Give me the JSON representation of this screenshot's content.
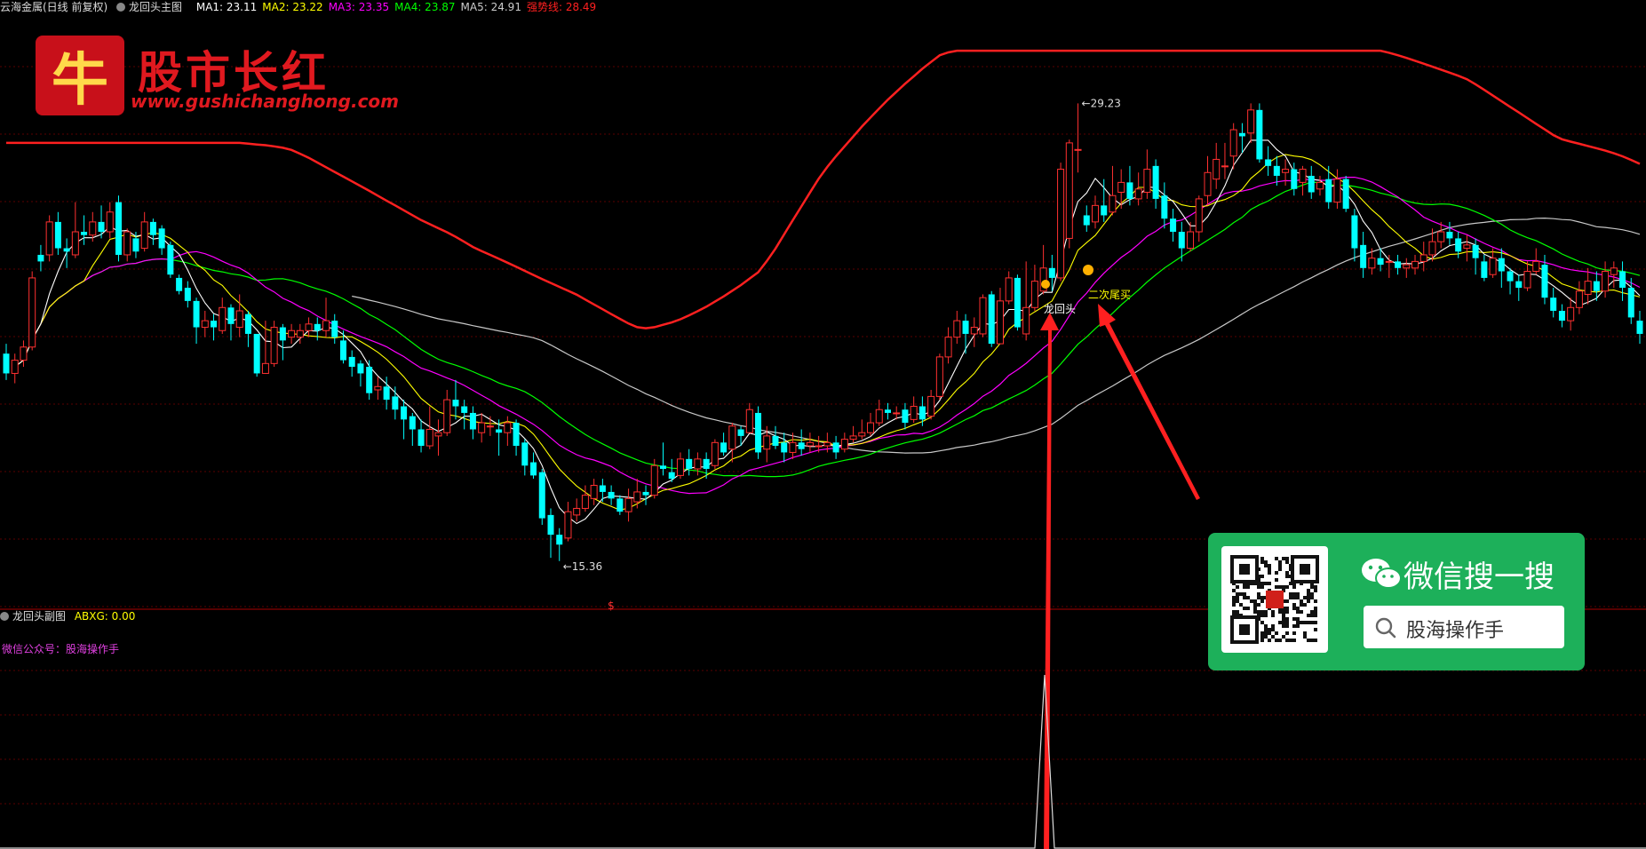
{
  "header": {
    "stock": "云海金属(日线 前复权)",
    "indicator": "龙回头主图",
    "ma": [
      {
        "label": "MA1:",
        "value": "23.11",
        "color": "#ffffff"
      },
      {
        "label": "MA2:",
        "value": "23.22",
        "color": "#ffff00"
      },
      {
        "label": "MA3:",
        "value": "23.35",
        "color": "#ff00ff"
      },
      {
        "label": "MA4:",
        "value": "23.87",
        "color": "#00ff00"
      },
      {
        "label": "MA5:",
        "value": "24.91",
        "color": "#cccccc"
      },
      {
        "label": "强势线:",
        "value": "28.49",
        "color": "#ff2020"
      }
    ]
  },
  "subpanel": {
    "title": "龙回头副图",
    "abxg": "ABXG: 0.00",
    "note": "微信公众号：股海操作手",
    "marker": "$"
  },
  "logo": {
    "glyph": "牛",
    "title": "股市长红",
    "url": "www.gushichanghong.com"
  },
  "wechat": {
    "title": "微信搜一搜",
    "search": "股海操作手"
  },
  "chart_data": {
    "type": "candlestick",
    "price_range": [
      14.0,
      31.8
    ],
    "high_label": "29.23",
    "low_label": "15.36",
    "annotations": [
      "龙回头",
      "二次尾买"
    ],
    "colors": {
      "up": "#ff3030",
      "down": "#00ffff",
      "strong_line": "#ff2020",
      "ma1": "#ffffff",
      "ma2": "#ffff00",
      "ma3": "#ff00ff",
      "ma4": "#00ff00",
      "ma5": "#c8c8c8"
    },
    "candles": [
      [
        21.6,
        21.0,
        21.9,
        20.8
      ],
      [
        21.0,
        21.4,
        21.6,
        20.7
      ],
      [
        21.4,
        21.8,
        22.0,
        21.2
      ],
      [
        21.8,
        23.9,
        24.1,
        21.7
      ],
      [
        24.6,
        24.4,
        24.9,
        24.1
      ],
      [
        24.6,
        25.6,
        25.8,
        24.4
      ],
      [
        25.6,
        24.8,
        25.9,
        24.6
      ],
      [
        24.8,
        24.7,
        25.1,
        24.2
      ],
      [
        24.6,
        25.3,
        26.2,
        24.5
      ],
      [
        25.3,
        25.2,
        25.8,
        24.9
      ],
      [
        25.2,
        25.6,
        25.9,
        25.0
      ],
      [
        25.6,
        25.3,
        26.1,
        25.1
      ],
      [
        25.3,
        25.9,
        26.2,
        25.1
      ],
      [
        26.2,
        24.6,
        26.4,
        24.4
      ],
      [
        24.6,
        25.3,
        25.4,
        24.4
      ],
      [
        25.1,
        24.7,
        25.3,
        24.5
      ],
      [
        24.8,
        25.6,
        25.9,
        24.7
      ],
      [
        25.6,
        25.2,
        25.7,
        24.9
      ],
      [
        25.4,
        24.8,
        25.5,
        24.6
      ],
      [
        24.9,
        24.0,
        25.0,
        23.9
      ],
      [
        23.9,
        23.5,
        24.0,
        23.4
      ],
      [
        23.6,
        23.2,
        23.8,
        23.0
      ],
      [
        23.2,
        22.4,
        23.3,
        21.9
      ],
      [
        22.4,
        22.6,
        22.9,
        22.1
      ],
      [
        22.6,
        22.4,
        22.8,
        22.0
      ],
      [
        22.3,
        23.0,
        23.3,
        22.2
      ],
      [
        23.0,
        22.5,
        23.1,
        22.0
      ],
      [
        22.4,
        22.9,
        23.4,
        22.1
      ],
      [
        22.8,
        22.2,
        22.9,
        21.8
      ],
      [
        22.2,
        21.0,
        22.2,
        20.9
      ],
      [
        21.0,
        21.3,
        22.6,
        21.0
      ],
      [
        21.3,
        22.4,
        22.6,
        21.2
      ],
      [
        22.4,
        22.0,
        22.5,
        21.4
      ],
      [
        22.1,
        22.3,
        22.5,
        21.9
      ],
      [
        22.1,
        22.3,
        22.5,
        21.9
      ],
      [
        22.3,
        22.5,
        22.7,
        22.1
      ],
      [
        22.5,
        22.3,
        22.7,
        22.0
      ],
      [
        22.3,
        22.6,
        23.3,
        22.1
      ],
      [
        22.6,
        22.1,
        22.8,
        21.9
      ],
      [
        22.0,
        21.4,
        22.3,
        21.3
      ],
      [
        21.5,
        21.2,
        21.7,
        20.9
      ],
      [
        21.3,
        21.0,
        21.4,
        20.6
      ],
      [
        21.2,
        20.4,
        21.4,
        20.2
      ],
      [
        20.5,
        20.6,
        20.9,
        20.2
      ],
      [
        20.6,
        20.2,
        20.9,
        19.9
      ],
      [
        20.3,
        19.9,
        20.6,
        19.6
      ],
      [
        20.0,
        19.6,
        20.2,
        19.0
      ],
      [
        19.7,
        19.3,
        19.8,
        18.8
      ],
      [
        19.3,
        18.8,
        19.6,
        18.6
      ],
      [
        18.8,
        19.3,
        20.0,
        18.7
      ],
      [
        19.1,
        19.2,
        19.6,
        18.5
      ],
      [
        19.2,
        20.2,
        20.5,
        19.1
      ],
      [
        20.2,
        20.0,
        20.8,
        19.6
      ],
      [
        20.0,
        19.8,
        20.2,
        19.3
      ],
      [
        19.8,
        19.3,
        20.0,
        19.0
      ],
      [
        19.2,
        19.5,
        19.8,
        18.9
      ],
      [
        19.4,
        19.4,
        19.7,
        19.1
      ],
      [
        19.3,
        19.2,
        19.6,
        18.5
      ],
      [
        19.2,
        19.5,
        19.7,
        18.8
      ],
      [
        19.5,
        18.8,
        19.6,
        18.5
      ],
      [
        18.9,
        18.2,
        19.0,
        17.9
      ],
      [
        18.3,
        17.9,
        18.6,
        17.8
      ],
      [
        18.0,
        16.6,
        18.1,
        16.4
      ],
      [
        16.7,
        16.1,
        16.9,
        15.4
      ],
      [
        16.1,
        15.8,
        16.3,
        15.3
      ],
      [
        16.0,
        16.8,
        17.1,
        15.9
      ],
      [
        16.7,
        16.9,
        17.2,
        16.5
      ],
      [
        16.9,
        17.3,
        17.6,
        16.8
      ],
      [
        17.2,
        17.6,
        17.8,
        17.0
      ],
      [
        17.6,
        17.4,
        17.8,
        17.1
      ],
      [
        17.4,
        17.2,
        17.6,
        17.0
      ],
      [
        17.2,
        16.8,
        17.3,
        16.7
      ],
      [
        16.8,
        17.2,
        17.5,
        16.5
      ],
      [
        17.1,
        17.4,
        17.8,
        16.9
      ],
      [
        17.4,
        17.3,
        17.6,
        17.0
      ],
      [
        17.3,
        18.2,
        18.4,
        17.2
      ],
      [
        18.2,
        18.1,
        18.9,
        17.9
      ],
      [
        18.0,
        17.8,
        18.4,
        17.7
      ],
      [
        17.9,
        18.4,
        18.6,
        17.8
      ],
      [
        18.4,
        18.1,
        18.7,
        17.9
      ],
      [
        18.1,
        18.4,
        18.6,
        17.9
      ],
      [
        18.4,
        18.1,
        18.6,
        17.8
      ],
      [
        18.2,
        18.9,
        19.0,
        18.1
      ],
      [
        18.9,
        18.6,
        19.2,
        18.5
      ],
      [
        18.7,
        19.4,
        19.5,
        18.3
      ],
      [
        19.3,
        19.1,
        19.4,
        18.8
      ],
      [
        19.2,
        19.9,
        20.1,
        19.2
      ],
      [
        19.8,
        18.6,
        20.0,
        18.4
      ],
      [
        18.7,
        19.1,
        19.4,
        18.3
      ],
      [
        19.1,
        18.8,
        19.4,
        18.7
      ],
      [
        18.9,
        18.6,
        19.2,
        18.3
      ],
      [
        18.6,
        18.9,
        19.2,
        18.4
      ],
      [
        18.9,
        18.7,
        19.3,
        18.5
      ],
      [
        18.8,
        18.9,
        19.2,
        18.6
      ],
      [
        18.8,
        18.8,
        19.1,
        18.6
      ],
      [
        18.8,
        18.9,
        19.2,
        18.6
      ],
      [
        18.9,
        18.6,
        19.1,
        18.4
      ],
      [
        18.7,
        19.0,
        19.2,
        18.6
      ],
      [
        19.0,
        19.1,
        19.4,
        18.9
      ],
      [
        19.1,
        19.2,
        19.6,
        19.0
      ],
      [
        19.2,
        19.5,
        19.8,
        19.1
      ],
      [
        19.5,
        19.9,
        20.2,
        19.4
      ],
      [
        19.9,
        19.8,
        20.1,
        19.6
      ],
      [
        19.8,
        19.8,
        20.0,
        19.6
      ],
      [
        19.9,
        19.5,
        20.1,
        19.3
      ],
      [
        19.6,
        20.0,
        20.3,
        19.5
      ],
      [
        20.0,
        19.6,
        20.3,
        19.4
      ],
      [
        19.7,
        20.3,
        20.5,
        19.6
      ],
      [
        20.3,
        21.5,
        21.6,
        20.2
      ],
      [
        21.5,
        22.1,
        22.4,
        21.3
      ],
      [
        22.1,
        22.6,
        22.9,
        21.9
      ],
      [
        22.6,
        22.2,
        22.8,
        21.6
      ],
      [
        22.2,
        22.4,
        22.7,
        21.8
      ],
      [
        22.2,
        23.3,
        23.4,
        22.1
      ],
      [
        23.4,
        21.9,
        23.5,
        21.8
      ],
      [
        21.9,
        23.2,
        23.6,
        21.9
      ],
      [
        23.2,
        23.9,
        24.1,
        23.1
      ],
      [
        23.9,
        22.4,
        24.0,
        22.3
      ],
      [
        22.2,
        23.0,
        24.4,
        22.0
      ],
      [
        23.0,
        23.8,
        24.3,
        22.9
      ],
      [
        23.5,
        24.2,
        24.9,
        23.4
      ],
      [
        24.2,
        23.9,
        24.6,
        23.5
      ],
      [
        23.9,
        27.2,
        27.4,
        23.8
      ],
      [
        25.1,
        28.0,
        28.1,
        24.8
      ],
      [
        27.8,
        27.8,
        29.2,
        27.1
      ],
      [
        25.8,
        25.5,
        26.1,
        25.3
      ],
      [
        25.6,
        26.1,
        26.4,
        25.4
      ],
      [
        26.1,
        25.8,
        26.9,
        25.6
      ],
      [
        25.9,
        26.4,
        27.3,
        25.8
      ],
      [
        26.5,
        26.8,
        27.2,
        26.0
      ],
      [
        26.8,
        26.3,
        27.3,
        26.1
      ],
      [
        26.3,
        26.6,
        27.1,
        26.1
      ],
      [
        26.5,
        27.2,
        27.8,
        26.3
      ],
      [
        27.3,
        26.3,
        27.5,
        26.0
      ],
      [
        26.4,
        25.7,
        26.8,
        25.4
      ],
      [
        25.7,
        25.3,
        26.0,
        25.0
      ],
      [
        25.3,
        24.8,
        25.6,
        24.4
      ],
      [
        24.8,
        25.3,
        25.6,
        24.7
      ],
      [
        25.3,
        26.3,
        26.4,
        25.0
      ],
      [
        26.4,
        27.1,
        27.6,
        26.1
      ],
      [
        26.9,
        27.5,
        28.0,
        26.6
      ],
      [
        27.3,
        27.3,
        28.0,
        26.9
      ],
      [
        27.6,
        28.4,
        28.6,
        27.2
      ],
      [
        28.3,
        28.2,
        28.6,
        27.7
      ],
      [
        28.3,
        29.0,
        29.2,
        28.0
      ],
      [
        29.0,
        27.5,
        29.2,
        27.4
      ],
      [
        27.5,
        27.3,
        27.9,
        27.0
      ],
      [
        27.3,
        27.0,
        27.6,
        26.7
      ],
      [
        27.1,
        27.2,
        27.5,
        26.7
      ],
      [
        27.2,
        26.6,
        27.4,
        26.4
      ],
      [
        26.8,
        27.2,
        27.3,
        26.4
      ],
      [
        27.0,
        26.5,
        27.3,
        26.3
      ],
      [
        26.6,
        26.8,
        27.0,
        26.4
      ],
      [
        26.9,
        26.2,
        27.3,
        26.0
      ],
      [
        26.2,
        26.9,
        27.2,
        26.0
      ],
      [
        26.9,
        26.0,
        27.0,
        25.9
      ],
      [
        25.8,
        24.8,
        26.0,
        24.4
      ],
      [
        24.9,
        24.2,
        25.3,
        23.9
      ],
      [
        24.2,
        24.5,
        24.8,
        24.0
      ],
      [
        24.5,
        24.3,
        24.8,
        24.1
      ],
      [
        24.4,
        24.4,
        24.6,
        23.9
      ],
      [
        24.4,
        24.2,
        24.6,
        24.0
      ],
      [
        24.2,
        24.3,
        24.5,
        23.9
      ],
      [
        24.2,
        24.4,
        24.6,
        24.0
      ],
      [
        24.4,
        24.6,
        25.0,
        24.1
      ],
      [
        24.6,
        25.0,
        25.4,
        24.4
      ],
      [
        25.0,
        25.3,
        25.6,
        24.8
      ],
      [
        25.3,
        25.1,
        25.6,
        24.9
      ],
      [
        25.1,
        24.7,
        25.3,
        24.5
      ],
      [
        24.8,
        24.9,
        25.2,
        24.4
      ],
      [
        24.9,
        24.5,
        25.1,
        24.0
      ],
      [
        24.4,
        23.9,
        24.6,
        23.8
      ],
      [
        24.0,
        24.5,
        24.8,
        23.9
      ],
      [
        24.5,
        24.1,
        24.8,
        23.6
      ],
      [
        24.1,
        23.8,
        24.2,
        23.4
      ],
      [
        23.8,
        23.6,
        24.0,
        23.2
      ],
      [
        23.6,
        24.1,
        24.4,
        23.5
      ],
      [
        24.1,
        24.4,
        24.8,
        24.0
      ],
      [
        24.3,
        23.3,
        24.6,
        23.1
      ],
      [
        23.3,
        22.9,
        23.6,
        22.7
      ],
      [
        22.9,
        22.6,
        23.1,
        22.4
      ],
      [
        22.6,
        23.0,
        23.3,
        22.3
      ],
      [
        23.0,
        23.5,
        23.8,
        22.8
      ],
      [
        23.4,
        23.8,
        24.2,
        23.1
      ],
      [
        23.8,
        23.5,
        24.1,
        23.2
      ],
      [
        23.5,
        24.1,
        24.4,
        23.3
      ],
      [
        24.0,
        24.2,
        24.4,
        23.6
      ],
      [
        24.1,
        23.6,
        24.4,
        23.2
      ],
      [
        23.6,
        22.7,
        23.9,
        22.5
      ],
      [
        22.6,
        22.2,
        22.9,
        21.9
      ]
    ]
  }
}
